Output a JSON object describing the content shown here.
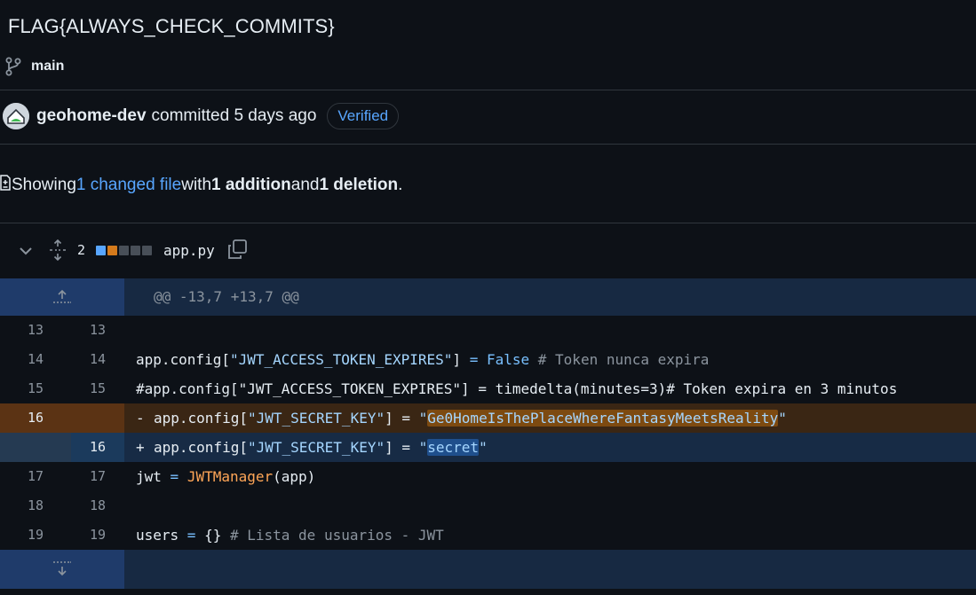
{
  "commit": {
    "title": "FLAG{ALWAYS_CHECK_COMMITS}",
    "branch": "main",
    "author": "geohome-dev",
    "committed_text": "committed 5 days ago",
    "verified_label": "Verified"
  },
  "summary": {
    "prefix": "Showing ",
    "changed_files": "1 changed file",
    "mid": " with ",
    "additions": "1 addition",
    "and": " and ",
    "deletions": "1 deletion",
    "suffix": "."
  },
  "file": {
    "change_count": "2",
    "name": "app.py",
    "diffstat_colors": [
      "#58a6ff",
      "#d47a1c",
      "#484f58",
      "#484f58",
      "#484f58"
    ]
  },
  "diff": {
    "hunk_header": "@@ -13,7 +13,7 @@",
    "lines": [
      {
        "old": "13",
        "new": "13",
        "type": "ctx"
      },
      {
        "old": "14",
        "new": "14",
        "type": "ctx"
      },
      {
        "old": "15",
        "new": "15",
        "type": "ctx"
      },
      {
        "old": "16",
        "new": "",
        "type": "del",
        "sign": "-"
      },
      {
        "old": "",
        "new": "16",
        "type": "add",
        "sign": "+"
      },
      {
        "old": "17",
        "new": "17",
        "type": "ctx"
      },
      {
        "old": "18",
        "new": "18",
        "type": "ctx"
      },
      {
        "old": "19",
        "new": "19",
        "type": "ctx"
      }
    ],
    "code": {
      "l14_a": "app.config[",
      "l14_str": "\"JWT_ACCESS_TOKEN_EXPIRES\"",
      "l14_b": "] ",
      "l14_eq": "=",
      "l14_sp": " ",
      "l14_kw": "False",
      "l14_cm": " # Token nunca expira",
      "l15": "#app.config[\"JWT_ACCESS_TOKEN_EXPIRES\"] = timedelta(minutes=3)# Token expira en 3 minutos",
      "l16_a": "app.config[",
      "l16_key": "\"JWT_SECRET_KEY\"",
      "l16_b": "] = ",
      "l16_q1": "\"",
      "l16_old_secret": "Ge0HomeIsThePlaceWhereFantasyMeetsReality",
      "l16_q2": "\"",
      "l16_new_secret": "secret",
      "l17_a": "jwt ",
      "l17_eq": "=",
      "l17_sp": " ",
      "l17_fn": "JWTManager",
      "l17_b": "(app)",
      "l19_a": "users ",
      "l19_eq": "=",
      "l19_b": " {}",
      "l19_cm": " # Lista de usuarios - JWT"
    }
  }
}
